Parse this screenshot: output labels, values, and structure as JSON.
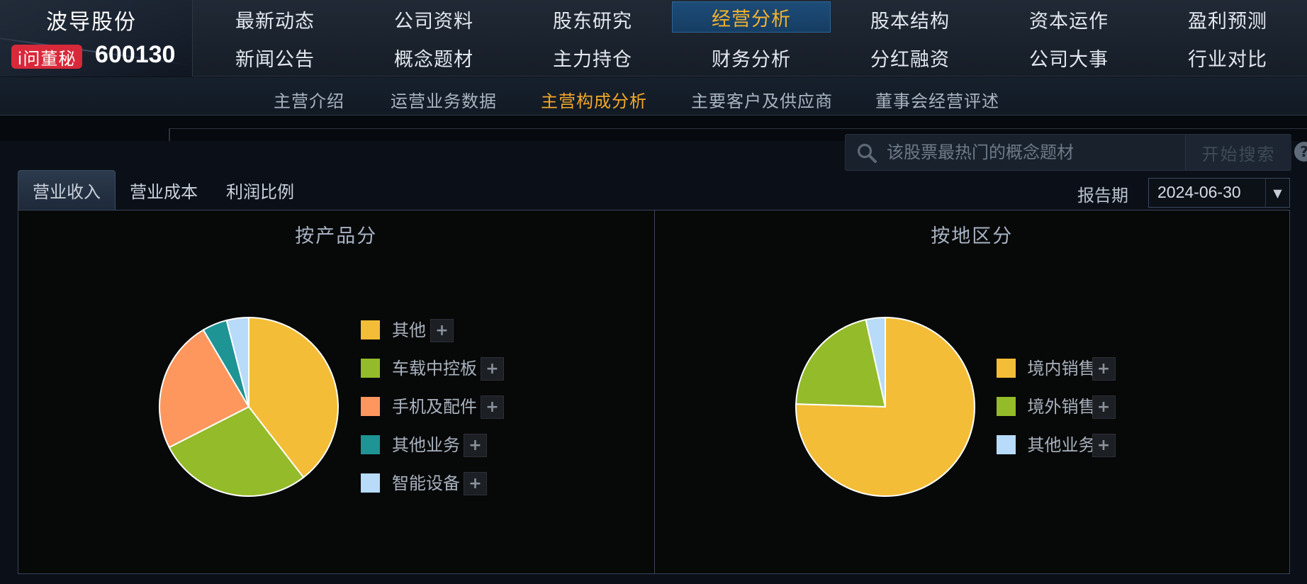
{
  "brand": {
    "company_name": "波导股份",
    "badge_label": "i问董秘",
    "stock_code": "600130"
  },
  "main_nav": [
    {
      "label": "最新动态",
      "active": false
    },
    {
      "label": "公司资料",
      "active": false
    },
    {
      "label": "股东研究",
      "active": false
    },
    {
      "label": "经营分析",
      "active": true
    },
    {
      "label": "股本结构",
      "active": false
    },
    {
      "label": "资本运作",
      "active": false
    },
    {
      "label": "盈利预测",
      "active": false
    },
    {
      "label": "新闻公告",
      "active": false
    },
    {
      "label": "概念题材",
      "active": false
    },
    {
      "label": "主力持仓",
      "active": false
    },
    {
      "label": "财务分析",
      "active": false
    },
    {
      "label": "分红融资",
      "active": false
    },
    {
      "label": "公司大事",
      "active": false
    },
    {
      "label": "行业对比",
      "active": false
    }
  ],
  "sub_nav": [
    {
      "label": "主营介绍",
      "active": false
    },
    {
      "label": "运营业务数据",
      "active": false
    },
    {
      "label": "主营构成分析",
      "active": true
    },
    {
      "label": "主要客户及供应商",
      "active": false
    },
    {
      "label": "董事会经营评述",
      "active": false
    }
  ],
  "search": {
    "placeholder": "该股票最热门的概念题材",
    "button_label": "开始搜索",
    "help_label": "?"
  },
  "tabs": [
    {
      "label": "营业收入",
      "active": true
    },
    {
      "label": "营业成本",
      "active": false
    },
    {
      "label": "利润比例",
      "active": false
    }
  ],
  "report_period": {
    "label": "报告期",
    "value": "2024-06-30"
  },
  "legend_expand_symbol": "+",
  "chart_data": [
    {
      "type": "pie",
      "title": "按产品分",
      "categories": [
        "其他",
        "车载中控板",
        "手机及配件",
        "其他业务",
        "智能设备"
      ],
      "values": [
        39.5,
        28.0,
        24.0,
        4.5,
        4.0
      ],
      "colors": [
        "#f4bd37",
        "#94bb2a",
        "#fd975e",
        "#1e9494",
        "#b7dbf8"
      ],
      "legend_position": "right"
    },
    {
      "type": "pie",
      "title": "按地区分",
      "categories": [
        "境内销售",
        "境外销售",
        "其他业务"
      ],
      "values": [
        75.5,
        21.0,
        3.5
      ],
      "colors": [
        "#f4bd37",
        "#94bb2a",
        "#b7dbf8"
      ],
      "legend_position": "right"
    }
  ]
}
